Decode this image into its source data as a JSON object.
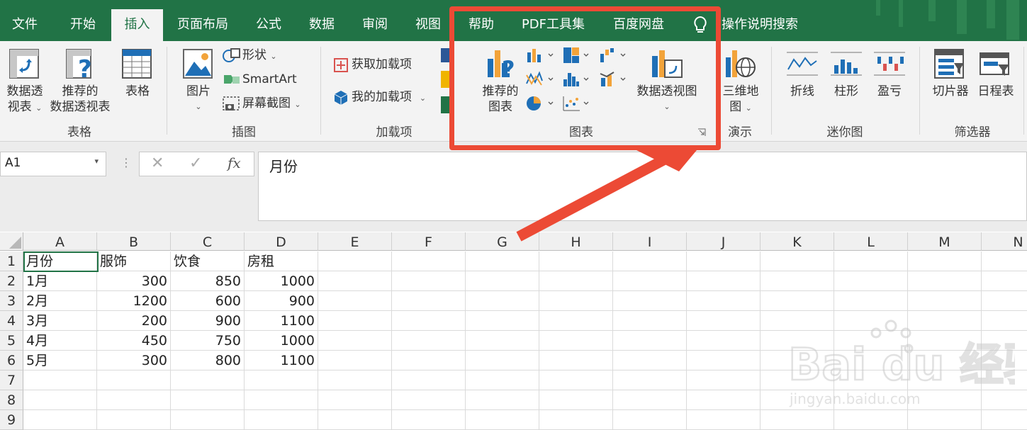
{
  "tabs": [
    {
      "label": "文件"
    },
    {
      "label": "开始"
    },
    {
      "label": "插入"
    },
    {
      "label": "页面布局"
    },
    {
      "label": "公式"
    },
    {
      "label": "数据"
    },
    {
      "label": "审阅"
    },
    {
      "label": "视图"
    },
    {
      "label": "帮助"
    },
    {
      "label": "PDF工具集"
    },
    {
      "label": "百度网盘"
    }
  ],
  "tell_me": "操作说明搜索",
  "ribbon": {
    "tables": {
      "pivot_line1": "数据透",
      "pivot_line2": "视表",
      "recommended_line1": "推荐的",
      "recommended_line2": "数据透视表",
      "table": "表格",
      "group": "表格"
    },
    "illustrations": {
      "pictures": "图片",
      "shapes": "形状",
      "smartart": "SmartArt",
      "screenshot": "屏幕截图",
      "group": "插图"
    },
    "addins": {
      "get": "获取加载项",
      "my": "我的加载项",
      "group": "加载项"
    },
    "charts": {
      "recommended_line1": "推荐的",
      "recommended_line2": "图表",
      "pivot_chart": "数据透视图",
      "group": "图表"
    },
    "tours": {
      "map_line1": "三维地",
      "map_line2": "图",
      "group": "演示"
    },
    "sparklines": {
      "line": "折线",
      "column": "柱形",
      "winloss": "盈亏",
      "group": "迷你图"
    },
    "filters": {
      "slicer": "切片器",
      "timeline": "日程表",
      "group": "筛选器"
    }
  },
  "namebox": "A1",
  "formula": "月份",
  "fx": "fx",
  "columns": [
    "A",
    "B",
    "C",
    "D",
    "E",
    "F",
    "G",
    "H",
    "I",
    "J",
    "K",
    "L",
    "M",
    "N"
  ],
  "rows": [
    "1",
    "2",
    "3",
    "4",
    "5",
    "6",
    "7",
    "8",
    "9"
  ],
  "cells": [
    [
      "月份",
      "服饰",
      "饮食",
      "房租"
    ],
    [
      "1月",
      "300",
      "850",
      "1000"
    ],
    [
      "2月",
      "1200",
      "600",
      "900"
    ],
    [
      "3月",
      "200",
      "900",
      "1100"
    ],
    [
      "4月",
      "450",
      "750",
      "1000"
    ],
    [
      "5月",
      "300",
      "800",
      "1100"
    ]
  ],
  "watermark": {
    "brand": "Bai du 经验",
    "url": "jingyan.baidu.com"
  },
  "colors": {
    "excel_green": "#217346",
    "annotation_red": "#ec4a35"
  }
}
